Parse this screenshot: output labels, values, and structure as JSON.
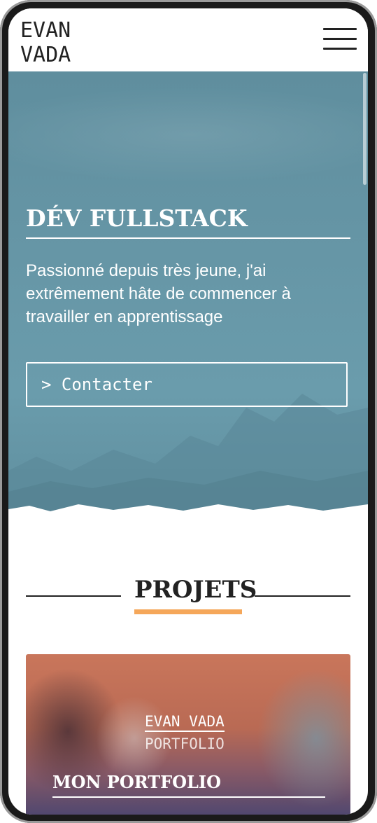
{
  "header": {
    "logo_line1": "EVAN",
    "logo_line2": "VADA",
    "menu_icon": "hamburger-icon"
  },
  "hero": {
    "title": "DÉV FULLSTACK",
    "text": "Passionné depuis très jeune, j'ai extrêmement hâte de commencer à travailler en apprentissage",
    "contact_button": "> Contacter",
    "background_color": "#6696a6"
  },
  "projects": {
    "section_title": "PROJETS",
    "accent_color": "#f5a75a",
    "cards": [
      {
        "logo_line1": "EVAN VADA",
        "logo_line2": "PORTFOLIO",
        "title": "MON PORTFOLIO"
      }
    ]
  }
}
